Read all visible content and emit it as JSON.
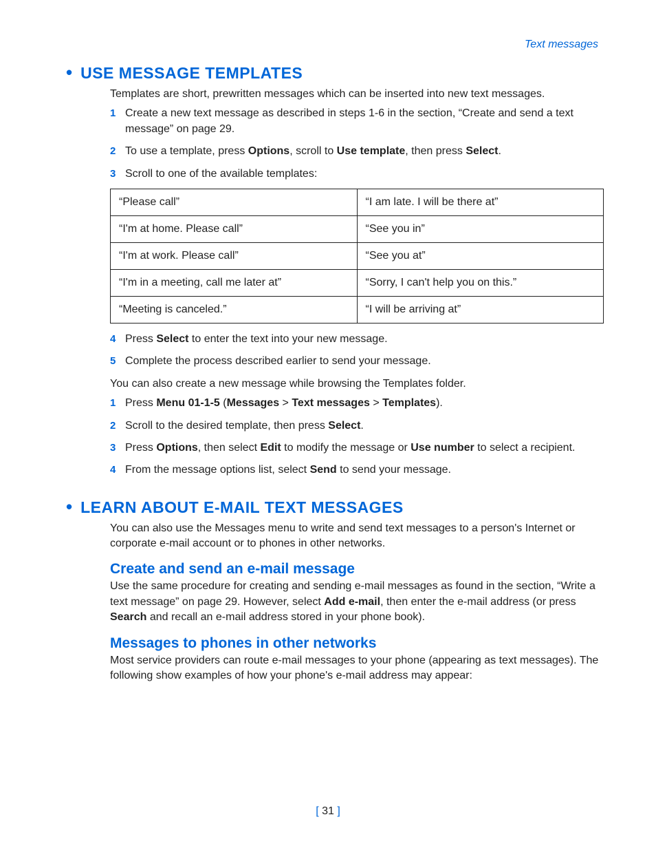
{
  "header": {
    "breadcrumb": "Text messages"
  },
  "section1": {
    "title": "USE MESSAGE TEMPLATES",
    "intro": "Templates are short, prewritten messages which can be inserted into new text messages.",
    "steps_a": [
      {
        "n": "1",
        "text": "Create a new text message as described in steps 1-6 in the section, “Create and send a text message” on page 29."
      },
      {
        "n": "2",
        "pre": "To use a template, press ",
        "b1": "Options",
        "mid1": ", scroll to ",
        "b2": "Use template",
        "mid2": ", then press ",
        "b3": "Select",
        "post": "."
      },
      {
        "n": "3",
        "text": "Scroll to one of the available templates:"
      }
    ],
    "templates": [
      [
        "“Please call”",
        "“I am late. I will be there at”"
      ],
      [
        "“I'm at home. Please call”",
        "“See you in”"
      ],
      [
        "“I'm at work. Please call”",
        "“See you at”"
      ],
      [
        "“I'm in a meeting, call me later at”",
        "“Sorry, I can't help you on this.”"
      ],
      [
        "“Meeting is canceled.”",
        "“I will be arriving at”"
      ]
    ],
    "steps_b": [
      {
        "n": "4",
        "pre": "Press ",
        "b1": "Select",
        "post": " to enter the text into your new message."
      },
      {
        "n": "5",
        "text": "Complete the process described earlier to send your message."
      }
    ],
    "after_para": "You can also create a new message while browsing the Templates folder.",
    "steps_c": [
      {
        "n": "1",
        "pre": "Press ",
        "b1": "Menu 01-1-5",
        "mid1": " (",
        "b2": "Messages",
        "mid2": " > ",
        "b3": "Text messages",
        "mid3": " > ",
        "b4": "Templates",
        "post": ")."
      },
      {
        "n": "2",
        "pre": "Scroll to the desired template, then press ",
        "b1": "Select",
        "post": "."
      },
      {
        "n": "3",
        "pre": "Press ",
        "b1": "Options",
        "mid1": ", then select ",
        "b2": "Edit",
        "mid2": " to modify the message or ",
        "b3": "Use number",
        "post": " to select a recipient."
      },
      {
        "n": "4",
        "pre": "From the message options list, select ",
        "b1": "Send",
        "post": " to send your message."
      }
    ]
  },
  "section2": {
    "title": "LEARN ABOUT E-MAIL TEXT MESSAGES",
    "intro": "You can also use the Messages menu to write and send text messages to a person's Internet or corporate e-mail account or to phones in other networks.",
    "sub1_title": "Create and send an e-mail message",
    "sub1": {
      "pre": "Use the same procedure for creating and sending e-mail messages as found in the section, “Write a text message” on page 29. However, select ",
      "b1": "Add e-mail",
      "mid1": ", then enter the e-mail address (or press ",
      "b2": "Search",
      "post": " and recall an e-mail address stored in your phone book)."
    },
    "sub2_title": "Messages to phones in other networks",
    "sub2_text": "Most service providers can route e-mail messages to your phone (appearing as text messages). The following show examples of how your phone's e-mail address may appear:"
  },
  "page_number": {
    "open": "[ ",
    "num": "31",
    "close": " ]"
  }
}
